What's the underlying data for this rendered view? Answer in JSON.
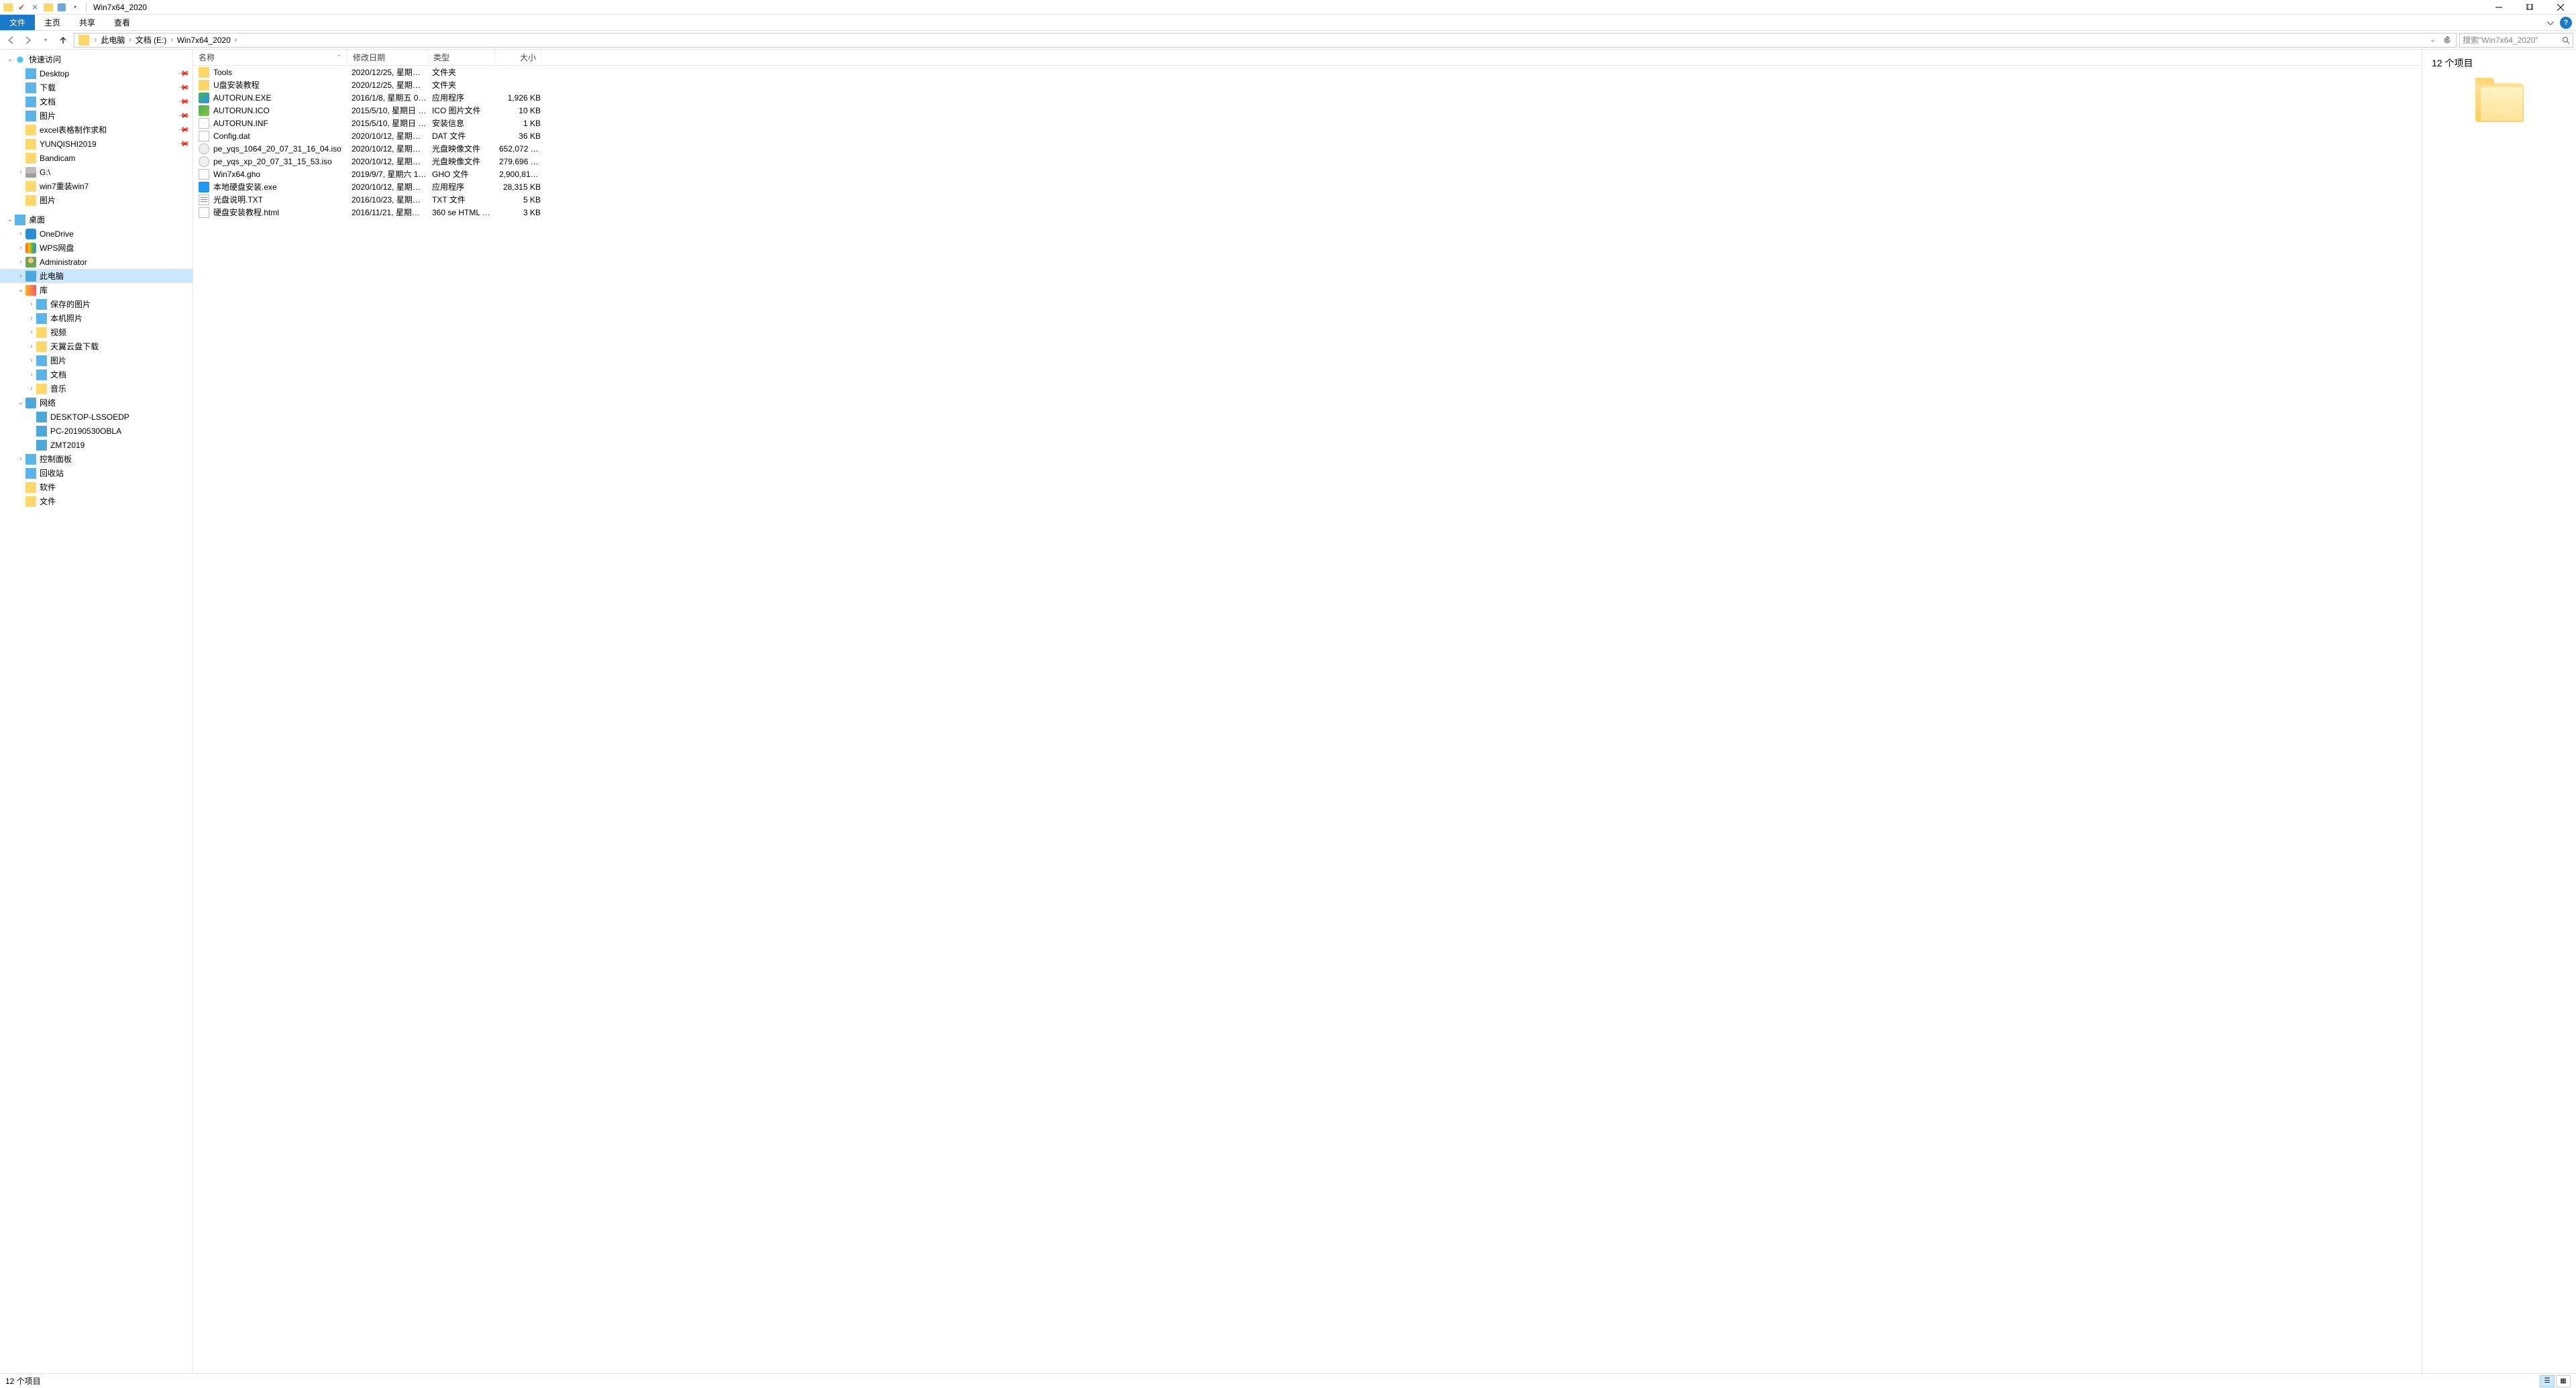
{
  "window": {
    "title": "Win7x64_2020"
  },
  "ribbon": {
    "file": "文件",
    "home": "主页",
    "share": "共享",
    "view": "查看"
  },
  "breadcrumb": {
    "items": [
      "此电脑",
      "文档 (E:)",
      "Win7x64_2020"
    ]
  },
  "search": {
    "placeholder": "搜索\"Win7x64_2020\""
  },
  "tree": {
    "quick": "快速访问",
    "groups": [
      [
        {
          "label": "Desktop",
          "icon": "ic-desktop",
          "pinned": true,
          "indent": 1
        },
        {
          "label": "下载",
          "icon": "ic-down",
          "pinned": true,
          "indent": 1
        },
        {
          "label": "文档",
          "icon": "ic-doc",
          "pinned": true,
          "indent": 1
        },
        {
          "label": "图片",
          "icon": "ic-pic",
          "pinned": true,
          "indent": 1
        },
        {
          "label": "excel表格制作求和",
          "icon": "ic-folder",
          "pinned": true,
          "indent": 1
        },
        {
          "label": "YUNQISHI2019",
          "icon": "ic-folder",
          "pinned": true,
          "indent": 1
        },
        {
          "label": "Bandicam",
          "icon": "ic-folder",
          "pinned": false,
          "indent": 1
        },
        {
          "label": "G:\\",
          "icon": "ic-drive",
          "pinned": false,
          "indent": 1,
          "haschild": true
        },
        {
          "label": "win7重装win7",
          "icon": "ic-folder",
          "pinned": false,
          "indent": 1
        },
        {
          "label": "图片",
          "icon": "ic-folder",
          "pinned": false,
          "indent": 1
        }
      ]
    ],
    "roots": [
      {
        "label": "桌面",
        "icon": "ic-desktop",
        "indent": 0,
        "haschild": true,
        "expanded": true
      },
      {
        "label": "OneDrive",
        "icon": "ic-onedrive",
        "indent": 1,
        "haschild": true
      },
      {
        "label": "WPS网盘",
        "icon": "ic-wps",
        "indent": 1,
        "haschild": true
      },
      {
        "label": "Administrator",
        "icon": "ic-user",
        "indent": 1,
        "haschild": true
      },
      {
        "label": "此电脑",
        "icon": "ic-pc",
        "indent": 1,
        "haschild": true,
        "selected": true
      },
      {
        "label": "库",
        "icon": "ic-lib",
        "indent": 1,
        "haschild": true,
        "expanded": true
      },
      {
        "label": "保存的图片",
        "icon": "ic-pic",
        "indent": 2,
        "haschild": true
      },
      {
        "label": "本机照片",
        "icon": "ic-pic",
        "indent": 2,
        "haschild": true
      },
      {
        "label": "视频",
        "icon": "ic-folder",
        "indent": 2,
        "haschild": true
      },
      {
        "label": "天翼云盘下载",
        "icon": "ic-folder",
        "indent": 2,
        "haschild": true
      },
      {
        "label": "图片",
        "icon": "ic-pic",
        "indent": 2,
        "haschild": true
      },
      {
        "label": "文档",
        "icon": "ic-doc",
        "indent": 2,
        "haschild": true
      },
      {
        "label": "音乐",
        "icon": "ic-folder",
        "indent": 2,
        "haschild": true
      },
      {
        "label": "网络",
        "icon": "ic-net",
        "indent": 1,
        "haschild": true,
        "expanded": true
      },
      {
        "label": "DESKTOP-LSSOEDP",
        "icon": "ic-pc",
        "indent": 2
      },
      {
        "label": "PC-20190530OBLA",
        "icon": "ic-pc",
        "indent": 2
      },
      {
        "label": "ZMT2019",
        "icon": "ic-pc",
        "indent": 2
      },
      {
        "label": "控制面板",
        "icon": "ic-panel",
        "indent": 1,
        "haschild": true
      },
      {
        "label": "回收站",
        "icon": "ic-recycle",
        "indent": 1
      },
      {
        "label": "软件",
        "icon": "ic-folder",
        "indent": 1
      },
      {
        "label": "文件",
        "icon": "ic-folder",
        "indent": 1
      }
    ]
  },
  "columns": {
    "name": "名称",
    "date": "修改日期",
    "type": "类型",
    "size": "大小"
  },
  "files": [
    {
      "name": "Tools",
      "date": "2020/12/25, 星期五 1...",
      "type": "文件夹",
      "size": "",
      "icon": "fi-folder"
    },
    {
      "name": "U盘安装教程",
      "date": "2020/12/25, 星期五 1...",
      "type": "文件夹",
      "size": "",
      "icon": "fi-folder"
    },
    {
      "name": "AUTORUN.EXE",
      "date": "2016/1/8, 星期五 04:...",
      "type": "应用程序",
      "size": "1,926 KB",
      "icon": "fi-exe"
    },
    {
      "name": "AUTORUN.ICO",
      "date": "2015/5/10, 星期日 02...",
      "type": "ICO 图片文件",
      "size": "10 KB",
      "icon": "fi-ico"
    },
    {
      "name": "AUTORUN.INF",
      "date": "2015/5/10, 星期日 02...",
      "type": "安装信息",
      "size": "1 KB",
      "icon": "fi-inf"
    },
    {
      "name": "Config.dat",
      "date": "2020/10/12, 星期一 1...",
      "type": "DAT 文件",
      "size": "36 KB",
      "icon": "fi-dat"
    },
    {
      "name": "pe_yqs_1064_20_07_31_16_04.iso",
      "date": "2020/10/12, 星期一 1...",
      "type": "光盘映像文件",
      "size": "652,072 KB",
      "icon": "fi-iso"
    },
    {
      "name": "pe_yqs_xp_20_07_31_15_53.iso",
      "date": "2020/10/12, 星期一 1...",
      "type": "光盘映像文件",
      "size": "279,696 KB",
      "icon": "fi-iso"
    },
    {
      "name": "Win7x64.gho",
      "date": "2019/9/7, 星期六 19:...",
      "type": "GHO 文件",
      "size": "2,900,813...",
      "icon": "fi-gho"
    },
    {
      "name": "本地硬盘安装.exe",
      "date": "2020/10/12, 星期一 1...",
      "type": "应用程序",
      "size": "28,315 KB",
      "icon": "fi-exe2"
    },
    {
      "name": "光盘说明.TXT",
      "date": "2016/10/23, 星期日 0...",
      "type": "TXT 文件",
      "size": "5 KB",
      "icon": "fi-txt"
    },
    {
      "name": "硬盘安装教程.html",
      "date": "2016/11/21, 星期一 2...",
      "type": "360 se HTML Do...",
      "size": "3 KB",
      "icon": "fi-html"
    }
  ],
  "preview": {
    "title": "12 个项目"
  },
  "status": {
    "text": "12 个项目"
  }
}
